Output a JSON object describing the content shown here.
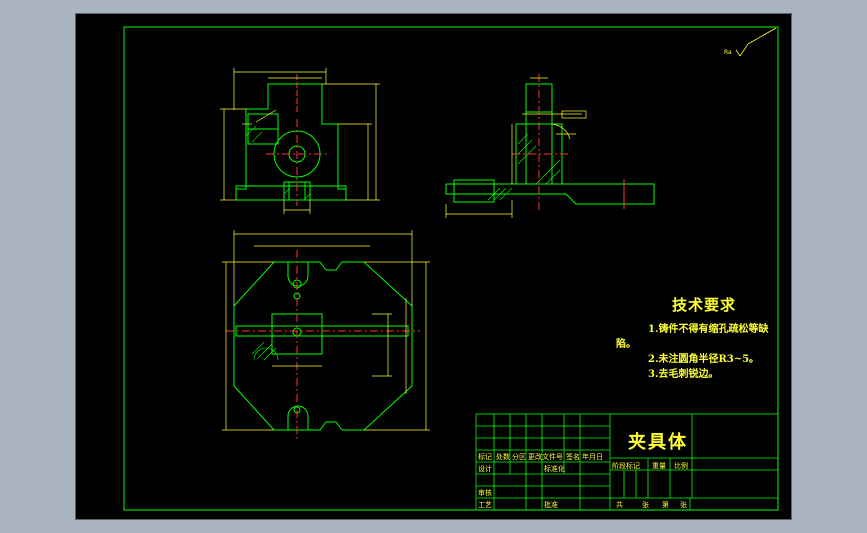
{
  "colors": {
    "background": "#a9b4c0",
    "canvas": "#000000",
    "frame": "#00ff00",
    "outline": "#00ff00",
    "dimension": "#ffff33",
    "centerline": "#ff3333",
    "title_text": "#ffff33"
  },
  "tech_requirements": {
    "title": "技术要求",
    "line1": "1.铸件不得有缩孔疏松等缺",
    "line1b": "陷。",
    "line2": "2.未注圆角半径R3~5。",
    "line3": "3.去毛刺锐边。"
  },
  "title_block": {
    "part_name": "夹具体",
    "row_labels": [
      "标记",
      "处数",
      "分区",
      "更改文件号",
      "签名",
      "年月日"
    ],
    "design": "设计",
    "standardization": "标准化",
    "review": "审核",
    "process": "工艺",
    "approve": "批准",
    "stage_mark": "阶段标记",
    "weight": "重量",
    "scale": "比例",
    "total": "共",
    "sheet": "张",
    "page_of": "第",
    "page_sheet": "张"
  }
}
